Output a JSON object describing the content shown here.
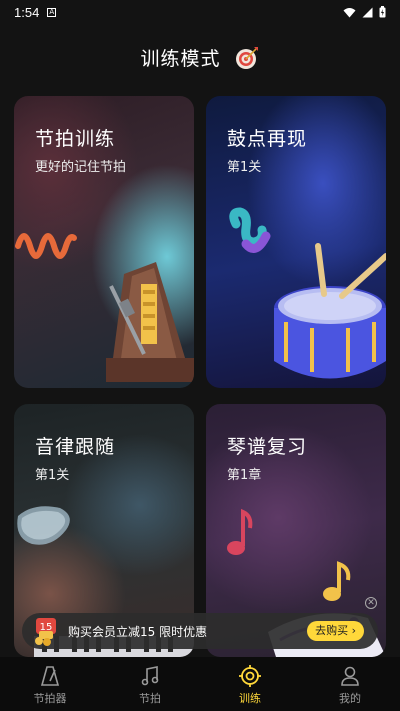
{
  "status": {
    "time": "1:54",
    "a_icon": "A"
  },
  "header": {
    "title": "训练模式"
  },
  "cards": [
    {
      "title": "节拍训练",
      "subtitle": "更好的记住节拍"
    },
    {
      "title": "鼓点再现",
      "subtitle": "第1关"
    },
    {
      "title": "音律跟随",
      "subtitle": "第1关"
    },
    {
      "title": "琴谱复习",
      "subtitle": "第1章"
    }
  ],
  "promo": {
    "badge": "15",
    "text": "购买会员立减15  限时优惠",
    "button": "去购买 ›"
  },
  "tabs": [
    {
      "label": "节拍器",
      "icon": "metronome-icon"
    },
    {
      "label": "节拍",
      "icon": "music-note-icon"
    },
    {
      "label": "训练",
      "icon": "target-icon",
      "active": true
    },
    {
      "label": "我的",
      "icon": "user-icon"
    }
  ],
  "colors": {
    "accent": "#ffd83a",
    "background": "#131313"
  }
}
